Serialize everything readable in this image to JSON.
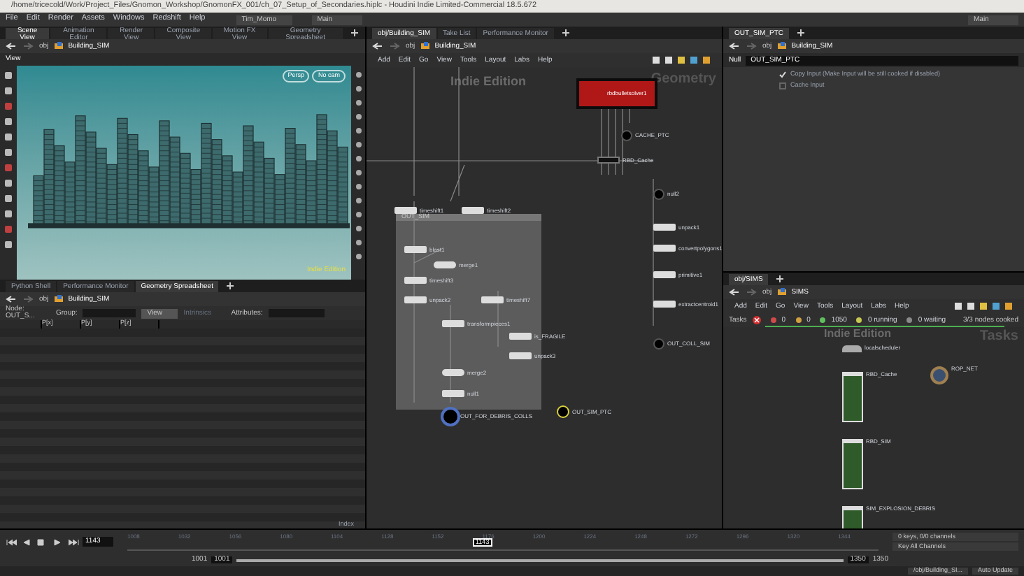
{
  "title_bar": {
    "title": "/home/tricecold/Work/Project_Files/Gnomon_Workshop/GnomonFX_001/ch_07_Setup_of_Secondaries.hiplc - Houdini Indie Limited-Commercial 18.5.672"
  },
  "main_menu": [
    "File",
    "Edit",
    "Render",
    "Assets",
    "Windows",
    "Redshift",
    "Help"
  ],
  "desktop": "Tim_Momo",
  "shelf_set": "Main",
  "right_desktop": "Main",
  "scene_pane": {
    "tabs": [
      {
        "label": "Scene View",
        "selected": true
      },
      {
        "label": "Animation Editor",
        "selected": false
      },
      {
        "label": "Render View",
        "selected": false
      },
      {
        "label": "Composite View",
        "selected": false
      },
      {
        "label": "Motion FX View",
        "selected": false
      },
      {
        "label": "Geometry Spreadsheet",
        "selected": false
      }
    ],
    "path": [
      "obj",
      "Building_SIM"
    ],
    "view_menu": "View",
    "camera_buttons": [
      "Persp",
      "No cam"
    ],
    "watermark": "Indie Edition"
  },
  "spreadsheet_pane": {
    "tabs": [
      {
        "label": "Python Shell",
        "selected": false
      },
      {
        "label": "Performance Monitor",
        "selected": false
      },
      {
        "label": "Geometry Spreadsheet",
        "selected": true
      }
    ],
    "path": [
      "obj",
      "Building_SIM"
    ],
    "node": "Node: OUT_S...",
    "group_label": "Group:",
    "view": "View",
    "intrinsics": "Intrinsics",
    "attributes_label": "Attributes:",
    "columns": [
      "P[x]",
      "P[y]",
      "P[z]"
    ],
    "footer": "Index"
  },
  "network_pane": {
    "tabs": [
      {
        "label": "obj/Building_SIM",
        "selected": true
      },
      {
        "label": "Take List",
        "selected": false
      },
      {
        "label": "Performance Monitor",
        "selected": false
      }
    ],
    "path": [
      "obj",
      "Building_SIM"
    ],
    "menu": [
      "Add",
      "Edit",
      "Go",
      "View",
      "Tools",
      "Layout",
      "Labs",
      "Help"
    ],
    "watermark": "Indie Edition",
    "context": "Geometry",
    "network_box": "OUT_SIM",
    "nodes": [
      {
        "kind": "subnet",
        "name": "rbdbulletsolver1"
      },
      {
        "kind": "null",
        "name": "CACHE_PTC"
      },
      {
        "kind": "cache",
        "name": "RBD_Cache"
      },
      {
        "kind": "null",
        "name": "null2"
      },
      {
        "kind": "sop",
        "name": "timeshift1"
      },
      {
        "kind": "sop",
        "name": "timeshift2"
      },
      {
        "kind": "sop",
        "name": "blast1"
      },
      {
        "kind": "merge",
        "name": "merge1"
      },
      {
        "kind": "sop",
        "name": "timeshift3"
      },
      {
        "kind": "sop",
        "name": "unpack2"
      },
      {
        "kind": "sop",
        "name": "timeshift7"
      },
      {
        "kind": "sop",
        "name": "transformpieces1"
      },
      {
        "kind": "sop",
        "name": "is_FRAGILE"
      },
      {
        "kind": "sop",
        "name": "unpack3"
      },
      {
        "kind": "merge",
        "name": "merge2"
      },
      {
        "kind": "sop",
        "name": "null1"
      },
      {
        "kind": "display",
        "name": "OUT_FOR_DEBRIS_COLLS"
      },
      {
        "kind": "current",
        "name": "OUT_SIM_PTC"
      },
      {
        "kind": "sop",
        "name": "unpack1"
      },
      {
        "kind": "sop",
        "name": "convertpolygons1"
      },
      {
        "kind": "sop",
        "name": "primitive1"
      },
      {
        "kind": "sop",
        "name": "extractcentroid1"
      },
      {
        "kind": "null",
        "name": "OUT_COLL_SIM"
      }
    ]
  },
  "parameter_pane": {
    "tab": "OUT_SIM_PTC",
    "path": [
      "obj",
      "Building_SIM"
    ],
    "node_type": "Null",
    "node_name": "OUT_SIM_PTC",
    "options": [
      {
        "label": "Copy Input (Make Input will be still cooked if disabled)",
        "checked": true
      },
      {
        "label": "Cache Input",
        "checked": false
      }
    ]
  },
  "tasks_pane": {
    "tab": "obj/SIMS",
    "path": [
      "obj",
      "SIMS"
    ],
    "menu": [
      "Add",
      "Edit",
      "Go",
      "View",
      "Tools",
      "Layout",
      "Labs",
      "Help"
    ],
    "label": "Tasks",
    "counts": [
      {
        "text": "0",
        "color": "#d04a4a"
      },
      {
        "text": "0",
        "color": "#d0a040"
      },
      {
        "text": "1050",
        "color": "#5fbf5f"
      },
      {
        "text": "0 running",
        "color": "#c8c850"
      },
      {
        "text": "0 waiting",
        "color": "#8a8a8a"
      }
    ],
    "cooked": "3/3 nodes cooked",
    "level": 1,
    "watermark": "Indie Edition",
    "context": "Tasks",
    "nodes": [
      {
        "kind": "scheduler",
        "name": "localscheduler"
      },
      {
        "kind": "rop",
        "name": "RBD_Cache"
      },
      {
        "kind": "rop",
        "name": "RBD_SIM"
      },
      {
        "kind": "rop",
        "name": "SIM_EXPLOSION_DEBRIS"
      },
      {
        "kind": "ropnet",
        "name": "ROP_NET"
      }
    ]
  },
  "timeline": {
    "frame": "1143",
    "current": "1143",
    "ticks": [
      "1008",
      "1032",
      "1056",
      "1080",
      "1104",
      "1128",
      "1152",
      "1176",
      "1200",
      "1224",
      "1248",
      "1272",
      "1296",
      "1320",
      "1344"
    ],
    "range": [
      "1001",
      "1001",
      "1350",
      "1350"
    ],
    "keys": "0 keys, 0/0 channels",
    "key_all": "Key All Channels",
    "node_path": "/obj/Building_SI...",
    "update": "Auto Update"
  }
}
